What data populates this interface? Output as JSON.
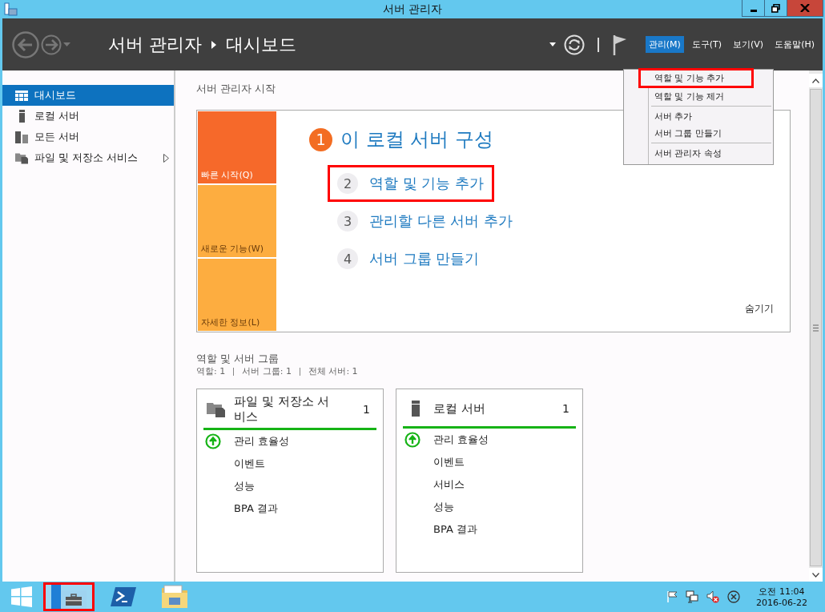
{
  "window": {
    "title": "서버 관리자"
  },
  "header": {
    "breadcrumb": [
      "서버 관리자",
      "대시보드"
    ],
    "menus": [
      {
        "label": "관리(M)",
        "selected": true
      },
      {
        "label": "도구(T)",
        "selected": false
      },
      {
        "label": "보기(V)",
        "selected": false
      },
      {
        "label": "도움말(H)",
        "selected": false
      }
    ]
  },
  "manage_menu": {
    "sections": [
      {
        "items": [
          {
            "label": "역할 및 기능 추가",
            "highlighted": true
          },
          {
            "label": "역할 및 기능 제거",
            "highlighted": false
          }
        ]
      },
      {
        "items": [
          {
            "label": "서버 추가",
            "highlighted": false
          },
          {
            "label": "서버 그룹 만들기",
            "highlighted": false
          }
        ]
      },
      {
        "items": [
          {
            "label": "서버 관리자 속성",
            "highlighted": false
          }
        ]
      }
    ]
  },
  "sidebar": {
    "items": [
      {
        "label": "대시보드",
        "kind": "dashboard",
        "selected": true,
        "has_submenu": false
      },
      {
        "label": "로컬 서버",
        "kind": "server",
        "selected": false,
        "has_submenu": false
      },
      {
        "label": "모든 서버",
        "kind": "servers",
        "selected": false,
        "has_submenu": false
      },
      {
        "label": "파일 및 저장소 서비스",
        "kind": "folder",
        "selected": false,
        "has_submenu": true
      }
    ]
  },
  "welcome": {
    "heading": "서버 관리자 시작",
    "tiles": [
      {
        "label": "빠른 시작(Q)",
        "selected": true
      },
      {
        "label": "새로운 기능(W)",
        "selected": false
      },
      {
        "label": "자세한 정보(L)",
        "selected": false
      }
    ],
    "steps": [
      {
        "number": "1",
        "label": "이 로컬 서버 구성",
        "kind": "main",
        "highlighted": false
      },
      {
        "number": "2",
        "label": "역할 및 기능 추가",
        "kind": "task",
        "highlighted": true
      },
      {
        "number": "3",
        "label": "관리할 다른 서버 추가",
        "kind": "task",
        "highlighted": false
      },
      {
        "number": "4",
        "label": "서버 그룹 만들기",
        "kind": "task",
        "highlighted": false
      }
    ],
    "hide_link": "숨기기"
  },
  "roles": {
    "heading": "역할 및 서버 그룹",
    "summary": [
      "역할: 1",
      "서버 그룹: 1",
      "전체 서버: 1"
    ],
    "cards": [
      {
        "title": "파일 및 저장소 서비스",
        "count": "1",
        "kind": "folder",
        "rows": [
          {
            "label": "관리 효율성",
            "status_up": true
          },
          {
            "label": "이벤트",
            "status_up": false
          },
          {
            "label": "성능",
            "status_up": false
          },
          {
            "label": "BPA 결과",
            "status_up": false
          }
        ]
      },
      {
        "title": "로컬 서버",
        "count": "1",
        "kind": "server",
        "rows": [
          {
            "label": "관리 효율성",
            "status_up": true
          },
          {
            "label": "이벤트",
            "status_up": false
          },
          {
            "label": "서비스",
            "status_up": false
          },
          {
            "label": "성능",
            "status_up": false
          },
          {
            "label": "BPA 결과",
            "status_up": false
          }
        ]
      }
    ]
  },
  "taskbar": {
    "apps": [
      {
        "kind": "start",
        "highlighted": false
      },
      {
        "kind": "server_manager",
        "highlighted": true
      },
      {
        "kind": "powershell",
        "highlighted": false
      },
      {
        "kind": "explorer",
        "highlighted": false
      }
    ],
    "clock": {
      "time": "오전 11:04",
      "date": "2016-06-22"
    }
  }
}
